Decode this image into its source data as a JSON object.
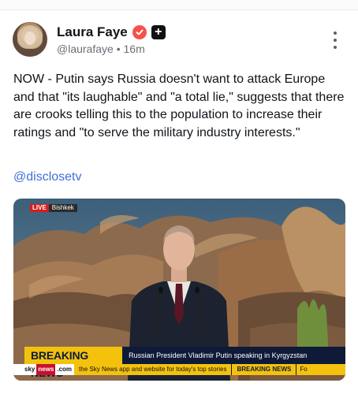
{
  "author": {
    "name": "Laura Faye",
    "handle": "@laurafaye",
    "separator": "•",
    "time": "16m",
    "plus_badge": "+"
  },
  "post": {
    "text": "NOW - Putin says Russia doesn't want to attack Europe and that \"its laughable\" and \"a total lie,\" suggests that there are crooks telling this to the population to increase their ratings and \"to serve the military industry interests.\"",
    "mention": "@disclosetv"
  },
  "media": {
    "live_label": "LIVE",
    "location": "Bishkek",
    "breaking_title": "BREAKING NEWS",
    "breaking_caption": "Russian President Vladimir Putin speaking in Kyrgyzstan",
    "ticker_logo_sky": "sky",
    "ticker_logo_news": "news",
    "ticker_logo_com": ".com",
    "ticker_text": "the Sky News app and website for today's top stories",
    "ticker_breaking": "BREAKING NEWS",
    "ticker_tail": "Fo"
  },
  "icons": {
    "verified": "verified-badge-icon",
    "more": "more-vertical-icon"
  },
  "colors": {
    "verified": "#f4524a",
    "mention": "#3f6fd8",
    "breaking_yellow": "#f4c20d",
    "breaking_navy": "#0e1a38",
    "live_red": "#d41e1e"
  }
}
